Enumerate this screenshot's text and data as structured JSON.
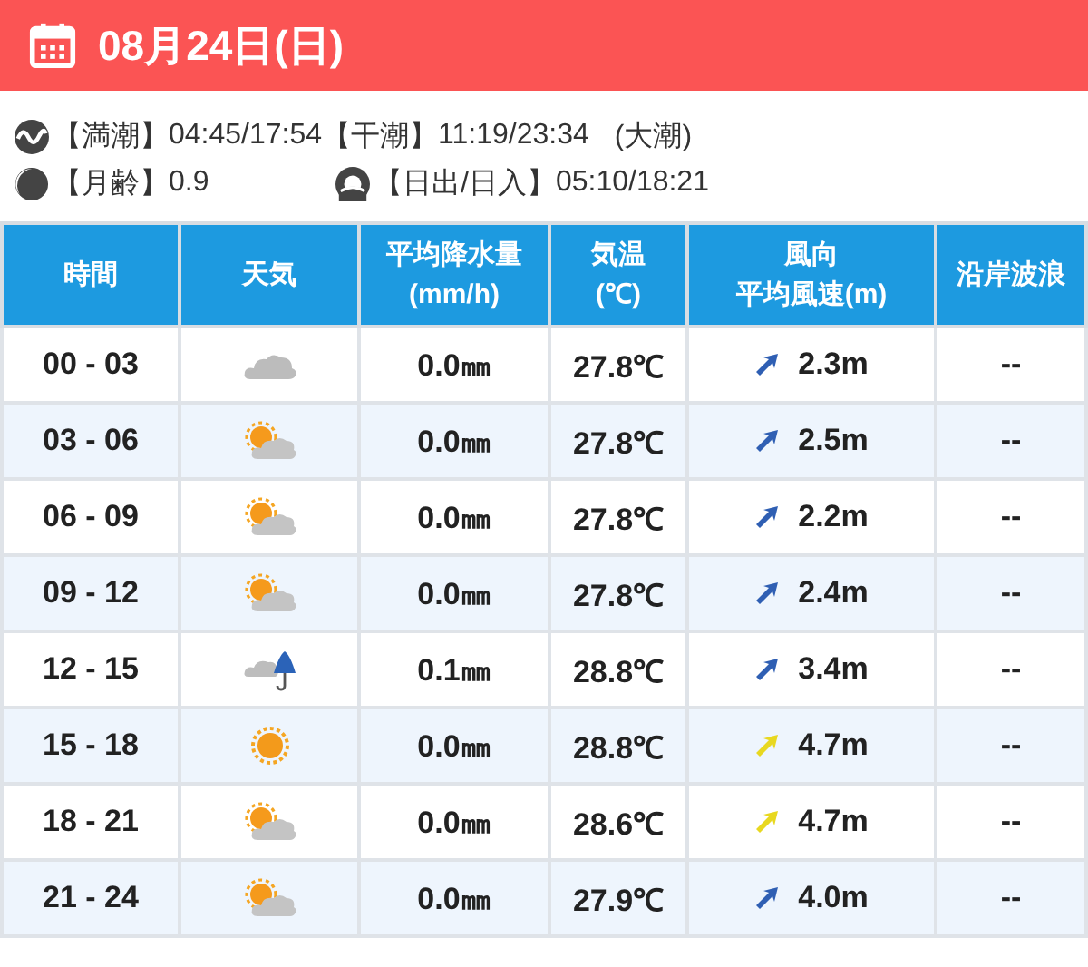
{
  "header": {
    "date": "08月24日(日)"
  },
  "tide": {
    "high_label": "【満潮】",
    "high": "04:45/17:54",
    "low_label": "【干潮】",
    "low": "11:19/23:34",
    "tide_name": "(大潮)"
  },
  "moon": {
    "label": "【月齢】",
    "value": "0.9"
  },
  "sun": {
    "label": "【日出/日入】",
    "value": "05:10/18:21"
  },
  "table": {
    "columns": [
      [
        "時間"
      ],
      [
        "天気"
      ],
      [
        "平均降水量",
        "(mm/h)"
      ],
      [
        "気温",
        "(℃)"
      ],
      [
        "風向",
        "平均風速(m)"
      ],
      [
        "沿岸波浪"
      ]
    ],
    "rows": [
      {
        "time": "00 - 03",
        "weather": {
          "kind": "cloudy"
        },
        "rain": "0.0㎜",
        "temp": "27.8℃",
        "wind": {
          "color": "#2f5fb3",
          "speed": "2.3m"
        },
        "wave": "--"
      },
      {
        "time": "03 - 06",
        "weather": {
          "kind": "partly-cloudy"
        },
        "rain": "0.0㎜",
        "temp": "27.8℃",
        "wind": {
          "color": "#2f5fb3",
          "speed": "2.5m"
        },
        "wave": "--"
      },
      {
        "time": "06 - 09",
        "weather": {
          "kind": "partly-cloudy"
        },
        "rain": "0.0㎜",
        "temp": "27.8℃",
        "wind": {
          "color": "#2f5fb3",
          "speed": "2.2m"
        },
        "wave": "--"
      },
      {
        "time": "09 - 12",
        "weather": {
          "kind": "partly-cloudy"
        },
        "rain": "0.0㎜",
        "temp": "27.8℃",
        "wind": {
          "color": "#2f5fb3",
          "speed": "2.4m"
        },
        "wave": "--"
      },
      {
        "time": "12 - 15",
        "weather": {
          "kind": "rain"
        },
        "rain": "0.1㎜",
        "temp": "28.8℃",
        "wind": {
          "color": "#2f5fb3",
          "speed": "3.4m"
        },
        "wave": "--"
      },
      {
        "time": "15 - 18",
        "weather": {
          "kind": "sunny"
        },
        "rain": "0.0㎜",
        "temp": "28.8℃",
        "wind": {
          "color": "#e8d820",
          "speed": "4.7m"
        },
        "wave": "--"
      },
      {
        "time": "18 - 21",
        "weather": {
          "kind": "partly-cloudy"
        },
        "rain": "0.0㎜",
        "temp": "28.6℃",
        "wind": {
          "color": "#e8d820",
          "speed": "4.7m"
        },
        "wave": "--"
      },
      {
        "time": "21 - 24",
        "weather": {
          "kind": "partly-cloudy"
        },
        "rain": "0.0㎜",
        "temp": "27.9℃",
        "wind": {
          "color": "#2f5fb3",
          "speed": "4.0m"
        },
        "wave": "--"
      }
    ]
  }
}
